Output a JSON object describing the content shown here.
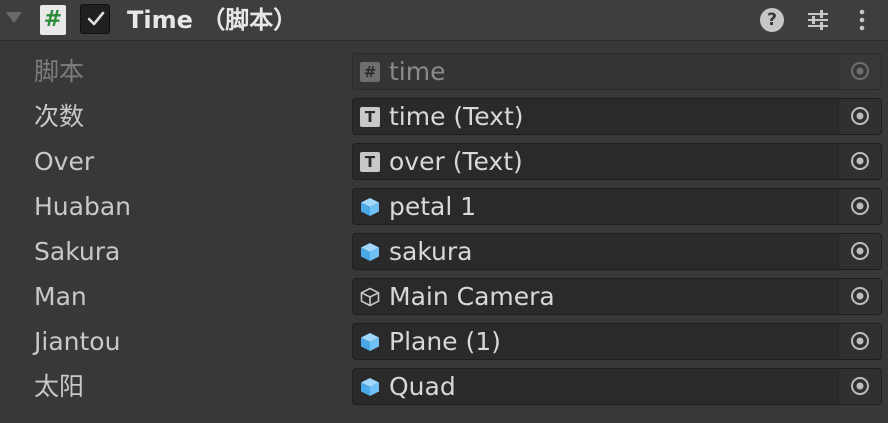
{
  "component": {
    "title": "Time （脚本）",
    "enabled": true
  },
  "header_icons": [
    "script-icon",
    "help-icon",
    "preset-icon",
    "menu-icon"
  ],
  "help_glyph": "?",
  "script_glyph": "#",
  "fields": [
    {
      "label": "脚本",
      "value": "time",
      "icon": "script-icon",
      "disabled": true
    },
    {
      "label": "次数",
      "value": "time (Text)",
      "icon": "text-icon",
      "disabled": false
    },
    {
      "label": "Over",
      "value": "over (Text)",
      "icon": "text-icon",
      "disabled": false
    },
    {
      "label": "Huaban",
      "value": "petal 1",
      "icon": "prefab-icon",
      "disabled": false
    },
    {
      "label": "Sakura",
      "value": "sakura",
      "icon": "prefab-icon",
      "disabled": false
    },
    {
      "label": "Man",
      "value": "Main Camera",
      "icon": "gameobject-icon",
      "disabled": false
    },
    {
      "label": "Jiantou",
      "value": "Plane (1)",
      "icon": "prefab-icon",
      "disabled": false
    },
    {
      "label": "太阳",
      "value": "Quad",
      "icon": "prefab-icon",
      "disabled": false
    }
  ],
  "colors": {
    "background": "#383838",
    "field": "#2a2a2a",
    "prefab_icon": "#5fb8f0",
    "script_hash": "#2e8b3a"
  }
}
